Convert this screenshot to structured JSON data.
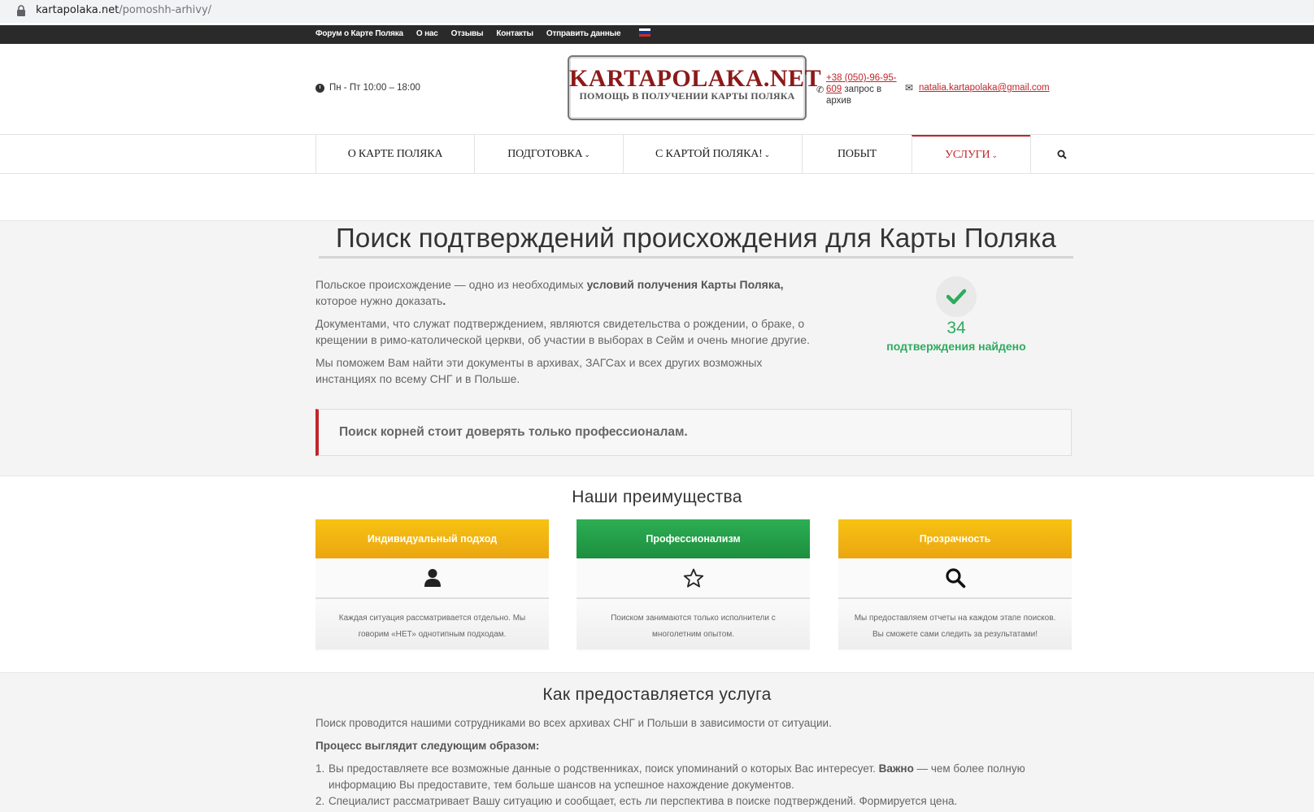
{
  "browser": {
    "url_domain": "kartapolaka.net",
    "url_path": "/pomoshh-arhivy/"
  },
  "topbar": {
    "links": [
      "Форум о Карте Поляка",
      "О нас",
      "Отзывы",
      "Контакты",
      "Отправить данные"
    ],
    "flag_colors": [
      "#ffffff",
      "#0039a6",
      "#d52b1e"
    ]
  },
  "header": {
    "hours": "Пн - Пт 10:00 – 18:00",
    "logo_title": "KARTAPOLAKA.NET",
    "logo_subtitle": "ПОМОЩЬ В ПОЛУЧЕНИИ КАРТЫ ПОЛЯКА",
    "phone_link": "+38 (050)-96-95-609",
    "phone_suffix": " запрос в архив",
    "email": "natalia.kartapolaka@gmail.com"
  },
  "nav": {
    "items": [
      {
        "label": "О КАРТЕ ПОЛЯКА",
        "dropdown": false
      },
      {
        "label": "ПОДГОТОВКА",
        "dropdown": true
      },
      {
        "label": "С КАРТОЙ ПОЛЯКА!",
        "dropdown": true
      },
      {
        "label": "ПОБЫТ",
        "dropdown": false
      },
      {
        "label": "УСЛУГИ",
        "dropdown": true,
        "active": true
      }
    ],
    "search_icon": "search-icon"
  },
  "hero": {
    "title": "Поиск подтверждений происхождения для Карты Поляка",
    "p1_a": "Польское происхождение — одно из необходимых ",
    "p1_b": "условий получения Карты Поляка,",
    "p1_c": " которое нужно доказать",
    "p1_d": ".",
    "p2": "Документами, что служат подтверждением, являются свидетельства о рождении, о браке, о крещении в римо-католической церкви, об участии в выборах в Сейм и очень многие другие.",
    "p3": "Мы поможем Вам найти эти документы в архивах, ЗАГСах и всех других возможных инстанциях по всему СНГ и в Польше.",
    "counter_value": "34",
    "counter_label": "подтверждения найдено",
    "quote": "Поиск корней стоит доверять только профессионалам."
  },
  "advantages": {
    "title": "Наши преимущества",
    "cards": [
      {
        "title": "Индивидуальный подход",
        "icon": "user-icon",
        "color": "#f1b712",
        "text": "Каждая ситуация рассматривается отдельно. Мы говорим «НЕТ» однотипным подходам."
      },
      {
        "title": "Профессионализм",
        "icon": "star-icon",
        "color": "#24a049",
        "text": "Поиском занимаются только исполнители с многолетним опытом."
      },
      {
        "title": "Прозрачность",
        "icon": "search-icon",
        "color": "#f1b712",
        "text": "Мы предоставляем отчеты на каждом этапе поисков. Вы сможете сами следить за результатами!"
      }
    ]
  },
  "process": {
    "title": "Как предоставляется услуга",
    "intro": "Поиск проводится нашими сотрудниками во всех архивах СНГ и Польши в зависимости от ситуации.",
    "subtitle": "Процесс выглядит следующим образом:",
    "step1_num": "1.",
    "step1_a": "Вы предоставляете все возможные данные о родственниках, поиск упоминаний о которых Вас интересует. ",
    "step1_b": "Важно",
    "step1_c": " — чем более полную информацию Вы предоставите, тем больше шансов на успешное нахождение документов.",
    "step2_num": "2.",
    "step2": "Специалист рассматривает Вашу ситуацию и сообщает, есть ли перспектива в поиске подтверждений. Формируется цена."
  },
  "colors": {
    "accent_red": "#c0262b",
    "success_green": "#2eab5f",
    "topbar_bg": "#2a2a2a"
  }
}
